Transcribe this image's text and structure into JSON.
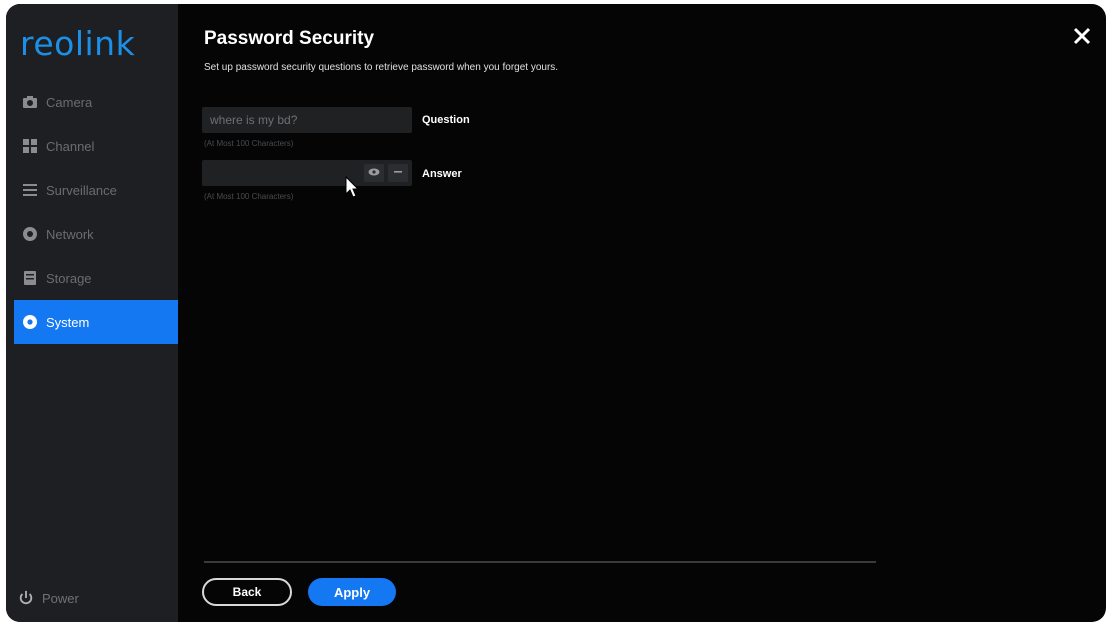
{
  "app": {
    "logo_text": "reolink",
    "brand_color": "#1c8fe8",
    "accent_color": "#1478f2"
  },
  "sidebar": {
    "items": [
      {
        "label": "Camera",
        "icon": "camera-icon",
        "active": false
      },
      {
        "label": "Channel",
        "icon": "channel-grid-icon",
        "active": false
      },
      {
        "label": "Surveillance",
        "icon": "list-icon",
        "active": false
      },
      {
        "label": "Network",
        "icon": "globe-icon",
        "active": false
      },
      {
        "label": "Storage",
        "icon": "storage-icon",
        "active": false
      },
      {
        "label": "System",
        "icon": "gear-icon",
        "active": true
      }
    ],
    "power_label": "Power"
  },
  "page": {
    "title": "Password Security",
    "subtitle": "Set up password security questions to retrieve password when you forget yours."
  },
  "form": {
    "question": {
      "value": "where is my bd?",
      "label": "Question",
      "hint": "(At Most 100 Characters)"
    },
    "answer": {
      "value": "",
      "label": "Answer",
      "hint": "(At Most 100 Characters)"
    }
  },
  "footer": {
    "back_label": "Back",
    "apply_label": "Apply"
  }
}
